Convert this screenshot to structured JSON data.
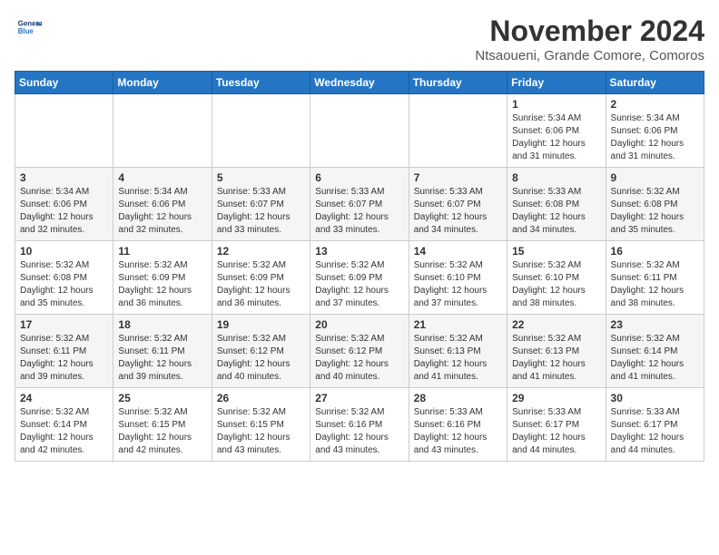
{
  "header": {
    "logo_line1": "General",
    "logo_line2": "Blue",
    "month": "November 2024",
    "location": "Ntsaoueni, Grande Comore, Comoros"
  },
  "weekdays": [
    "Sunday",
    "Monday",
    "Tuesday",
    "Wednesday",
    "Thursday",
    "Friday",
    "Saturday"
  ],
  "weeks": [
    [
      {
        "day": "",
        "info": ""
      },
      {
        "day": "",
        "info": ""
      },
      {
        "day": "",
        "info": ""
      },
      {
        "day": "",
        "info": ""
      },
      {
        "day": "",
        "info": ""
      },
      {
        "day": "1",
        "info": "Sunrise: 5:34 AM\nSunset: 6:06 PM\nDaylight: 12 hours and 31 minutes."
      },
      {
        "day": "2",
        "info": "Sunrise: 5:34 AM\nSunset: 6:06 PM\nDaylight: 12 hours and 31 minutes."
      }
    ],
    [
      {
        "day": "3",
        "info": "Sunrise: 5:34 AM\nSunset: 6:06 PM\nDaylight: 12 hours and 32 minutes."
      },
      {
        "day": "4",
        "info": "Sunrise: 5:34 AM\nSunset: 6:06 PM\nDaylight: 12 hours and 32 minutes."
      },
      {
        "day": "5",
        "info": "Sunrise: 5:33 AM\nSunset: 6:07 PM\nDaylight: 12 hours and 33 minutes."
      },
      {
        "day": "6",
        "info": "Sunrise: 5:33 AM\nSunset: 6:07 PM\nDaylight: 12 hours and 33 minutes."
      },
      {
        "day": "7",
        "info": "Sunrise: 5:33 AM\nSunset: 6:07 PM\nDaylight: 12 hours and 34 minutes."
      },
      {
        "day": "8",
        "info": "Sunrise: 5:33 AM\nSunset: 6:08 PM\nDaylight: 12 hours and 34 minutes."
      },
      {
        "day": "9",
        "info": "Sunrise: 5:32 AM\nSunset: 6:08 PM\nDaylight: 12 hours and 35 minutes."
      }
    ],
    [
      {
        "day": "10",
        "info": "Sunrise: 5:32 AM\nSunset: 6:08 PM\nDaylight: 12 hours and 35 minutes."
      },
      {
        "day": "11",
        "info": "Sunrise: 5:32 AM\nSunset: 6:09 PM\nDaylight: 12 hours and 36 minutes."
      },
      {
        "day": "12",
        "info": "Sunrise: 5:32 AM\nSunset: 6:09 PM\nDaylight: 12 hours and 36 minutes."
      },
      {
        "day": "13",
        "info": "Sunrise: 5:32 AM\nSunset: 6:09 PM\nDaylight: 12 hours and 37 minutes."
      },
      {
        "day": "14",
        "info": "Sunrise: 5:32 AM\nSunset: 6:10 PM\nDaylight: 12 hours and 37 minutes."
      },
      {
        "day": "15",
        "info": "Sunrise: 5:32 AM\nSunset: 6:10 PM\nDaylight: 12 hours and 38 minutes."
      },
      {
        "day": "16",
        "info": "Sunrise: 5:32 AM\nSunset: 6:11 PM\nDaylight: 12 hours and 38 minutes."
      }
    ],
    [
      {
        "day": "17",
        "info": "Sunrise: 5:32 AM\nSunset: 6:11 PM\nDaylight: 12 hours and 39 minutes."
      },
      {
        "day": "18",
        "info": "Sunrise: 5:32 AM\nSunset: 6:11 PM\nDaylight: 12 hours and 39 minutes."
      },
      {
        "day": "19",
        "info": "Sunrise: 5:32 AM\nSunset: 6:12 PM\nDaylight: 12 hours and 40 minutes."
      },
      {
        "day": "20",
        "info": "Sunrise: 5:32 AM\nSunset: 6:12 PM\nDaylight: 12 hours and 40 minutes."
      },
      {
        "day": "21",
        "info": "Sunrise: 5:32 AM\nSunset: 6:13 PM\nDaylight: 12 hours and 41 minutes."
      },
      {
        "day": "22",
        "info": "Sunrise: 5:32 AM\nSunset: 6:13 PM\nDaylight: 12 hours and 41 minutes."
      },
      {
        "day": "23",
        "info": "Sunrise: 5:32 AM\nSunset: 6:14 PM\nDaylight: 12 hours and 41 minutes."
      }
    ],
    [
      {
        "day": "24",
        "info": "Sunrise: 5:32 AM\nSunset: 6:14 PM\nDaylight: 12 hours and 42 minutes."
      },
      {
        "day": "25",
        "info": "Sunrise: 5:32 AM\nSunset: 6:15 PM\nDaylight: 12 hours and 42 minutes."
      },
      {
        "day": "26",
        "info": "Sunrise: 5:32 AM\nSunset: 6:15 PM\nDaylight: 12 hours and 43 minutes."
      },
      {
        "day": "27",
        "info": "Sunrise: 5:32 AM\nSunset: 6:16 PM\nDaylight: 12 hours and 43 minutes."
      },
      {
        "day": "28",
        "info": "Sunrise: 5:33 AM\nSunset: 6:16 PM\nDaylight: 12 hours and 43 minutes."
      },
      {
        "day": "29",
        "info": "Sunrise: 5:33 AM\nSunset: 6:17 PM\nDaylight: 12 hours and 44 minutes."
      },
      {
        "day": "30",
        "info": "Sunrise: 5:33 AM\nSunset: 6:17 PM\nDaylight: 12 hours and 44 minutes."
      }
    ]
  ]
}
